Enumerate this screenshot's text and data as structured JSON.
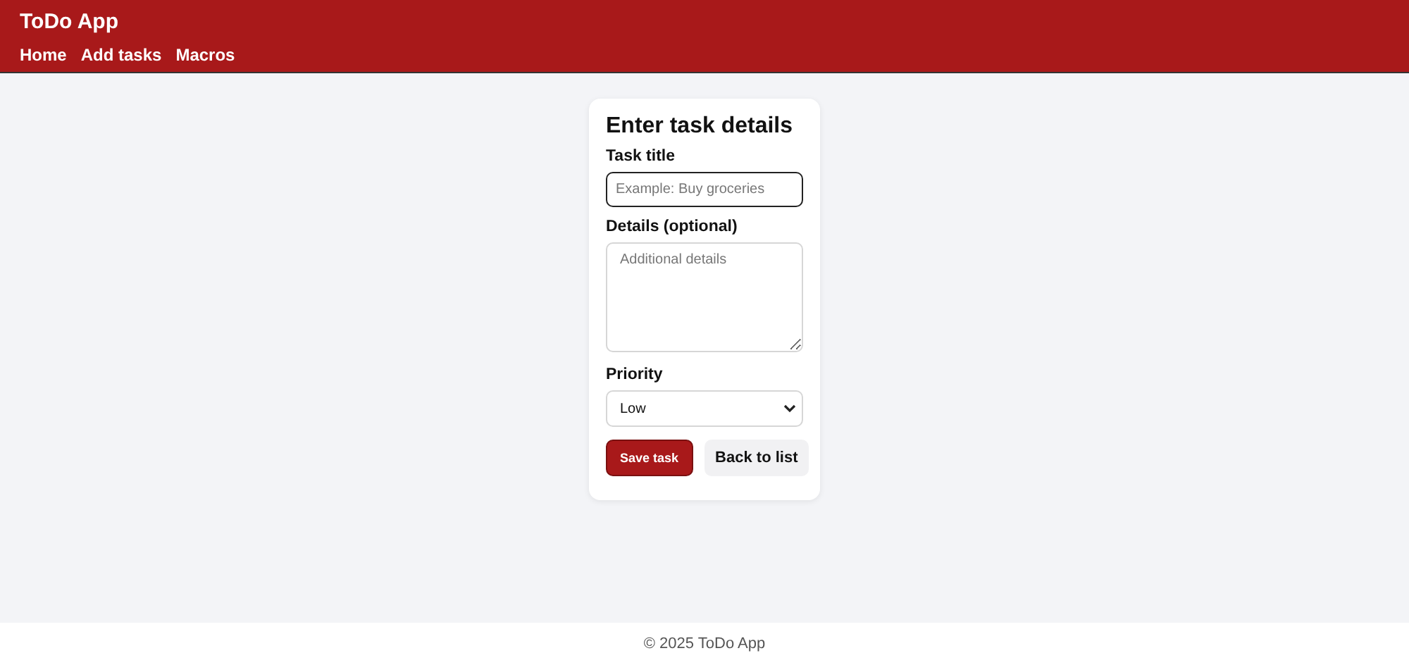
{
  "header": {
    "title": "ToDo App",
    "nav": [
      {
        "label": "Home"
      },
      {
        "label": "Add tasks"
      },
      {
        "label": "Macros"
      }
    ]
  },
  "form": {
    "heading": "Enter task details",
    "title_field": {
      "label": "Task title",
      "placeholder": "Example: Buy groceries",
      "focused": true
    },
    "details_field": {
      "label": "Details (optional)",
      "placeholder": "Additional details"
    },
    "priority_field": {
      "label": "Priority",
      "value": "Low"
    },
    "buttons": [
      {
        "label": "Save task",
        "kind": "primary"
      },
      {
        "label": "Back to list",
        "kind": "secondary"
      }
    ]
  },
  "footer": {
    "text": "© 2025 ToDo App"
  }
}
